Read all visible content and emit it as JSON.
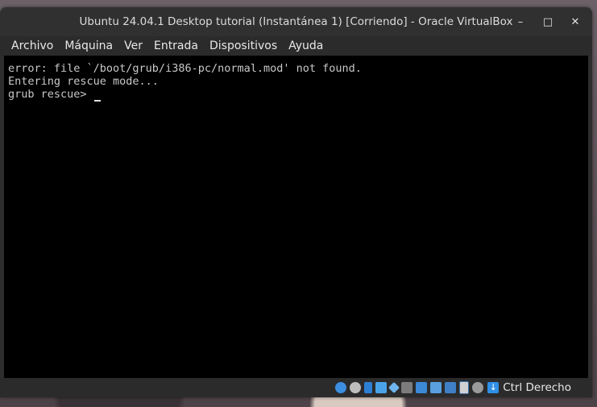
{
  "window": {
    "title": "Ubuntu 24.04.1 Desktop tutorial (Instantánea 1) [Corriendo] - Oracle VirtualBox",
    "minimize_glyph": "–",
    "maximize_glyph": "□",
    "close_glyph": "✕"
  },
  "menu": {
    "items": [
      "Archivo",
      "Máquina",
      "Ver",
      "Entrada",
      "Dispositivos",
      "Ayuda"
    ]
  },
  "console": {
    "lines": [
      "error: file `/boot/grub/i386-pc/normal.mod' not found.",
      "Entering rescue mode...",
      "grub rescue> "
    ]
  },
  "statusbar": {
    "icons": [
      "hard-disk-icon",
      "optical-drive-icon",
      "audio-icon",
      "network-icon",
      "usb-icon",
      "shared-folders-icon",
      "display-icon",
      "video-capture-icon",
      "cpu-icon",
      "vt-x-icon",
      "mouse-integration-icon"
    ],
    "host_key_label": "Ctrl Derecho"
  },
  "colors": {
    "console_bg": "#000000",
    "console_text": "#c8c8c8",
    "chrome": "#2b2b2b"
  }
}
